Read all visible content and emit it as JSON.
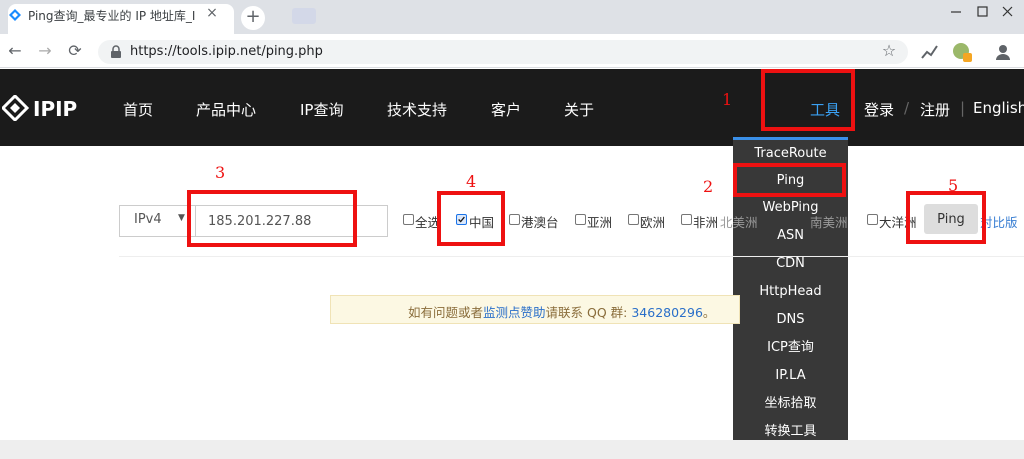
{
  "browser": {
    "tab_title": "Ping查询_最专业的 IP 地址库_IP",
    "tab_close": "×",
    "new_tab": "+",
    "url": "https://tools.ipip.net/ping.php",
    "back_icon": "←",
    "forward_icon": "→",
    "reload_icon": "⟳",
    "star_icon": "☆"
  },
  "nav": {
    "logo": "IPIP",
    "items": [
      "首页",
      "产品中心",
      "IP查询",
      "技术支持",
      "客户",
      "关于"
    ],
    "tools": "工具",
    "login": "登录",
    "register": "注册",
    "separator": "/",
    "bar": "|",
    "english": "English"
  },
  "dropdown": {
    "items": [
      "TraceRoute",
      "Ping",
      "WebPing",
      "ASN",
      "CDN",
      "HttpHead",
      "DNS",
      "ICP查询",
      "IP.LA",
      "坐标拾取",
      "转换工具"
    ]
  },
  "form": {
    "ip_version": "IPv4",
    "ip_value": "185.201.227.88",
    "regions": [
      "全选",
      "中国",
      "港澳台",
      "亚洲",
      "欧洲",
      "非洲",
      "北美洲",
      "南美洲",
      "大洋洲"
    ],
    "checked_region": "中国",
    "ping_button": "Ping",
    "compare_link": "对比版"
  },
  "notice": {
    "prefix": "如有问题或者",
    "link": "监测点赞助",
    "middle": "请联系 QQ 群: ",
    "qq": "346280296",
    "suffix": "。"
  },
  "annotations": {
    "n1": "1",
    "n2": "2",
    "n3": "3",
    "n4": "4",
    "n5": "5",
    "color": "#ee1111"
  },
  "colors": {
    "accent": "#3aa0f2",
    "navbar": "#1b1b1b",
    "dropdown": "#383838"
  }
}
